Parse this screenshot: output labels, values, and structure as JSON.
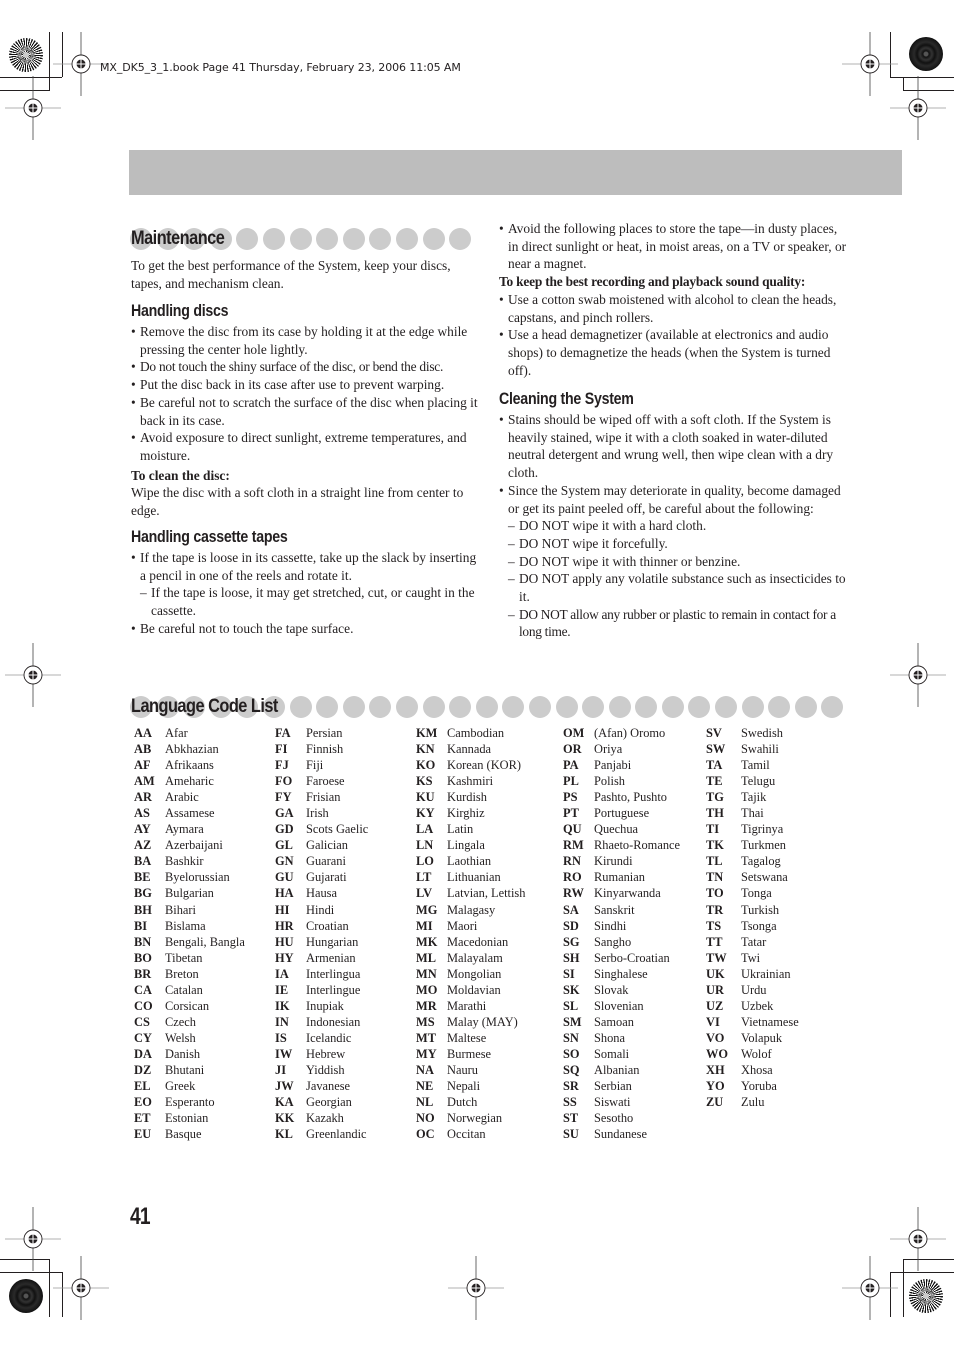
{
  "slug": "MX_DK5_3_1.book  Page 41  Thursday, February 23, 2006  11:05 AM",
  "maintenance": {
    "title": "Maintenance",
    "intro": "To get the best performance of the System, keep your discs, tapes, and mechanism clean.",
    "handling_discs": {
      "title": "Handling discs",
      "bullets": [
        "Remove the disc from its case by holding it at the edge while pressing the center hole lightly.",
        "Do not touch the shiny surface of the disc, or bend the disc.",
        "Put the disc back in its case after use to prevent warping.",
        "Be careful not to scratch the surface of the disc when placing it back in its case.",
        "Avoid exposure to direct sunlight, extreme temperatures, and moisture."
      ],
      "clean_heading": "To clean the disc:",
      "clean_text": "Wipe the disc with a soft cloth in a straight line from center to edge."
    },
    "handling_tapes": {
      "title": "Handling cassette tapes",
      "bullet1": "If the tape is loose in its cassette, take up the slack by inserting a pencil in one of the reels and rotate it.",
      "sub1": "If the tape is loose, it may get stretched, cut, or caught in the cassette.",
      "bullet2": "Be careful not to touch the tape surface.",
      "bullet3": "Avoid the following places to store the tape—in dusty places, in direct sunlight or heat, in moist areas, on a TV or speaker, or near a magnet."
    },
    "recording": {
      "heading": "To keep the best recording and playback sound quality:",
      "bullets": [
        "Use a cotton swab moistened with alcohol to clean the heads, capstans, and pinch rollers.",
        "Use a head demagnetizer (available at electronics and audio shops) to demagnetize the heads (when the System is turned off)."
      ]
    },
    "cleaning_system": {
      "title": "Cleaning the System",
      "bullet1": "Stains should be wiped off with a soft cloth. If the System is heavily stained, wipe it with a cloth soaked in water-diluted neutral detergent and wrung well, then wipe clean with a dry cloth.",
      "bullet2": "Since the System may deteriorate in quality, become damaged or get its paint peeled off, be careful about the following:",
      "subs": [
        "DO NOT wipe it with a hard cloth.",
        "DO NOT wipe it forcefully.",
        "DO NOT wipe it with thinner or benzine.",
        "DO NOT apply any volatile substance such as insecticides to it.",
        "DO NOT allow any rubber or plastic to remain in contact for a long time."
      ]
    }
  },
  "language_list": {
    "title": "Language Code List",
    "columns": [
      [
        [
          "AA",
          "Afar"
        ],
        [
          "AB",
          "Abkhazian"
        ],
        [
          "AF",
          "Afrikaans"
        ],
        [
          "AM",
          "Ameharic"
        ],
        [
          "AR",
          "Arabic"
        ],
        [
          "AS",
          "Assamese"
        ],
        [
          "AY",
          "Aymara"
        ],
        [
          "AZ",
          "Azerbaijani"
        ],
        [
          "BA",
          "Bashkir"
        ],
        [
          "BE",
          "Byelorussian"
        ],
        [
          "BG",
          "Bulgarian"
        ],
        [
          "BH",
          "Bihari"
        ],
        [
          "BI",
          "Bislama"
        ],
        [
          "BN",
          "Bengali, Bangla"
        ],
        [
          "BO",
          "Tibetan"
        ],
        [
          "BR",
          "Breton"
        ],
        [
          "CA",
          "Catalan"
        ],
        [
          "CO",
          "Corsican"
        ],
        [
          "CS",
          "Czech"
        ],
        [
          "CY",
          "Welsh"
        ],
        [
          "DA",
          "Danish"
        ],
        [
          "DZ",
          "Bhutani"
        ],
        [
          "EL",
          "Greek"
        ],
        [
          "EO",
          "Esperanto"
        ],
        [
          "ET",
          "Estonian"
        ],
        [
          "EU",
          "Basque"
        ]
      ],
      [
        [
          "FA",
          "Persian"
        ],
        [
          "FI",
          "Finnish"
        ],
        [
          "FJ",
          "Fiji"
        ],
        [
          "FO",
          "Faroese"
        ],
        [
          "FY",
          "Frisian"
        ],
        [
          "GA",
          "Irish"
        ],
        [
          "GD",
          "Scots Gaelic"
        ],
        [
          "GL",
          "Galician"
        ],
        [
          "GN",
          "Guarani"
        ],
        [
          "GU",
          "Gujarati"
        ],
        [
          "HA",
          "Hausa"
        ],
        [
          "HI",
          "Hindi"
        ],
        [
          "HR",
          "Croatian"
        ],
        [
          "HU",
          "Hungarian"
        ],
        [
          "HY",
          "Armenian"
        ],
        [
          "IA",
          "Interlingua"
        ],
        [
          "IE",
          "Interlingue"
        ],
        [
          "IK",
          "Inupiak"
        ],
        [
          "IN",
          "Indonesian"
        ],
        [
          "IS",
          "Icelandic"
        ],
        [
          "IW",
          "Hebrew"
        ],
        [
          "JI",
          "Yiddish"
        ],
        [
          "JW",
          "Javanese"
        ],
        [
          "KA",
          "Georgian"
        ],
        [
          "KK",
          "Kazakh"
        ],
        [
          "KL",
          "Greenlandic"
        ]
      ],
      [
        [
          "KM",
          "Cambodian"
        ],
        [
          "KN",
          "Kannada"
        ],
        [
          "KO",
          "Korean (KOR)"
        ],
        [
          "KS",
          "Kashmiri"
        ],
        [
          "KU",
          "Kurdish"
        ],
        [
          "KY",
          "Kirghiz"
        ],
        [
          "LA",
          "Latin"
        ],
        [
          "LN",
          "Lingala"
        ],
        [
          "LO",
          "Laothian"
        ],
        [
          "LT",
          "Lithuanian"
        ],
        [
          "LV",
          "Latvian, Lettish"
        ],
        [
          "MG",
          "Malagasy"
        ],
        [
          "MI",
          "Maori"
        ],
        [
          "MK",
          "Macedonian"
        ],
        [
          "ML",
          "Malayalam"
        ],
        [
          "MN",
          "Mongolian"
        ],
        [
          "MO",
          "Moldavian"
        ],
        [
          "MR",
          "Marathi"
        ],
        [
          "MS",
          "Malay (MAY)"
        ],
        [
          "MT",
          "Maltese"
        ],
        [
          "MY",
          "Burmese"
        ],
        [
          "NA",
          "Nauru"
        ],
        [
          "NE",
          "Nepali"
        ],
        [
          "NL",
          "Dutch"
        ],
        [
          "NO",
          "Norwegian"
        ],
        [
          "OC",
          "Occitan"
        ]
      ],
      [
        [
          "OM",
          "(Afan) Oromo"
        ],
        [
          "OR",
          "Oriya"
        ],
        [
          "PA",
          "Panjabi"
        ],
        [
          "PL",
          "Polish"
        ],
        [
          "PS",
          "Pashto, Pushto"
        ],
        [
          "PT",
          "Portuguese"
        ],
        [
          "QU",
          "Quechua"
        ],
        [
          "RM",
          "Rhaeto-Romance"
        ],
        [
          "RN",
          "Kirundi"
        ],
        [
          "RO",
          "Rumanian"
        ],
        [
          "RW",
          "Kinyarwanda"
        ],
        [
          "SA",
          "Sanskrit"
        ],
        [
          "SD",
          "Sindhi"
        ],
        [
          "SG",
          "Sangho"
        ],
        [
          "SH",
          "Serbo-Croatian"
        ],
        [
          "SI",
          "Singhalese"
        ],
        [
          "SK",
          "Slovak"
        ],
        [
          "SL",
          "Slovenian"
        ],
        [
          "SM",
          "Samoan"
        ],
        [
          "SN",
          "Shona"
        ],
        [
          "SO",
          "Somali"
        ],
        [
          "SQ",
          "Albanian"
        ],
        [
          "SR",
          "Serbian"
        ],
        [
          "SS",
          "Siswati"
        ],
        [
          "ST",
          "Sesotho"
        ],
        [
          "SU",
          "Sundanese"
        ]
      ],
      [
        [
          "SV",
          "Swedish"
        ],
        [
          "SW",
          "Swahili"
        ],
        [
          "TA",
          "Tamil"
        ],
        [
          "TE",
          "Telugu"
        ],
        [
          "TG",
          "Tajik"
        ],
        [
          "TH",
          "Thai"
        ],
        [
          "TI",
          "Tigrinya"
        ],
        [
          "TK",
          "Turkmen"
        ],
        [
          "TL",
          "Tagalog"
        ],
        [
          "TN",
          "Setswana"
        ],
        [
          "TO",
          "Tonga"
        ],
        [
          "TR",
          "Turkish"
        ],
        [
          "TS",
          "Tsonga"
        ],
        [
          "TT",
          "Tatar"
        ],
        [
          "TW",
          "Twi"
        ],
        [
          "UK",
          "Ukrainian"
        ],
        [
          "UR",
          "Urdu"
        ],
        [
          "UZ",
          "Uzbek"
        ],
        [
          "VI",
          "Vietnamese"
        ],
        [
          "VO",
          "Volapuk"
        ],
        [
          "WO",
          "Wolof"
        ],
        [
          "XH",
          "Xhosa"
        ],
        [
          "YO",
          "Yoruba"
        ],
        [
          "ZU",
          "Zulu"
        ]
      ]
    ]
  },
  "page_number": "41"
}
